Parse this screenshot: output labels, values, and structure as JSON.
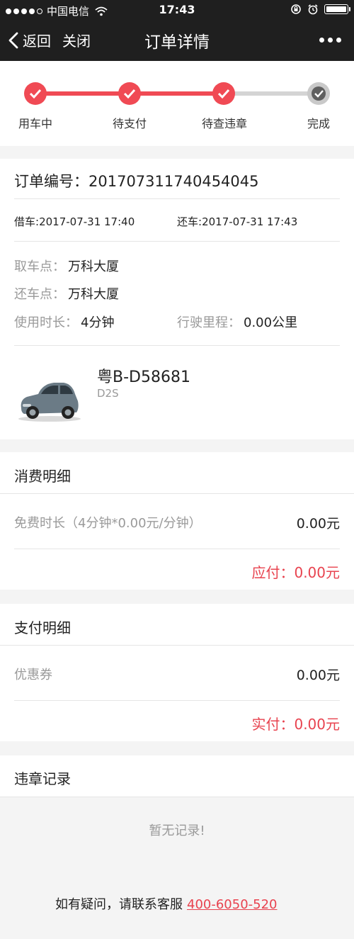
{
  "status_bar": {
    "carrier": "中国电信",
    "time": "17:43"
  },
  "navbar": {
    "back_label": "返回",
    "close_label": "关闭",
    "title": "订单详情"
  },
  "progress": {
    "steps": [
      {
        "label": "用车中",
        "state": "done"
      },
      {
        "label": "待支付",
        "state": "done"
      },
      {
        "label": "待查违章",
        "state": "done"
      },
      {
        "label": "完成",
        "state": "pending"
      }
    ],
    "accent_color": "#f04a54"
  },
  "order": {
    "number_label": "订单编号：",
    "number": "201707311740454045",
    "borrow_label": "借车:",
    "borrow_time": "2017-07-31 17:40",
    "return_label": "还车:",
    "return_time": "2017-07-31 17:43",
    "pickup_label": "取车点：",
    "pickup_value": "万科大厦",
    "dropoff_label": "还车点：",
    "dropoff_value": "万科大厦",
    "duration_label": "使用时长：",
    "duration_value": "4分钟",
    "mileage_label": "行驶里程：",
    "mileage_value": "0.00公里"
  },
  "car": {
    "plate": "粤B-D58681",
    "model": "D2S"
  },
  "consumption": {
    "title": "消费明细",
    "item_label": "免费时长（4分钟*0.00元/分钟）",
    "item_value": "0.00元",
    "payable": "应付：0.00元"
  },
  "payment": {
    "title": "支付明细",
    "item_label": "优惠券",
    "item_value": "0.00元",
    "paid": "实付：0.00元"
  },
  "violations": {
    "title": "违章记录",
    "empty": "暂无记录!"
  },
  "footer": {
    "text": "如有疑问，请联系客服",
    "phone": "400-6050-520"
  }
}
